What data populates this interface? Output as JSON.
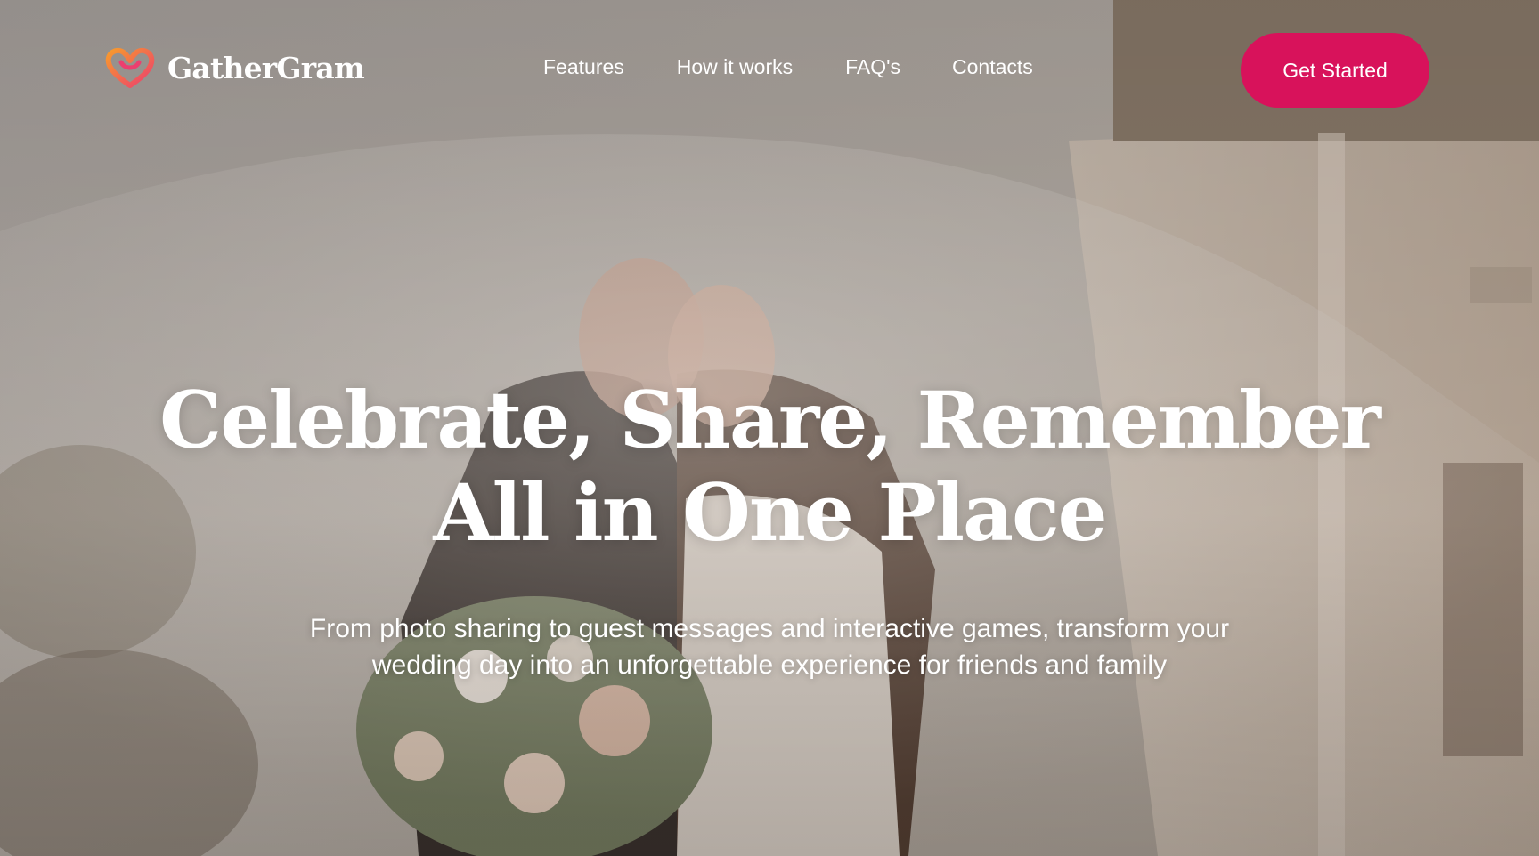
{
  "brand": {
    "name": "GatherGram",
    "icon": "heart-knot-icon",
    "accent_color": "#d8125b",
    "logo_gradient": [
      "#f79a2d",
      "#ec3f6f"
    ]
  },
  "nav": {
    "items": [
      {
        "label": "Features"
      },
      {
        "label": "How it works"
      },
      {
        "label": "FAQ's"
      },
      {
        "label": "Contacts"
      }
    ]
  },
  "cta": {
    "label": "Get Started"
  },
  "hero": {
    "headline_lines": [
      "Celebrate, Share, Remember",
      "All in One Place"
    ],
    "subtitle_lines": [
      "From photo sharing to guest messages and interactive games, transform your",
      "wedding day into an unforgettable experience for friends and family"
    ],
    "background_image": "wedding-couple-under-veil-photo"
  }
}
